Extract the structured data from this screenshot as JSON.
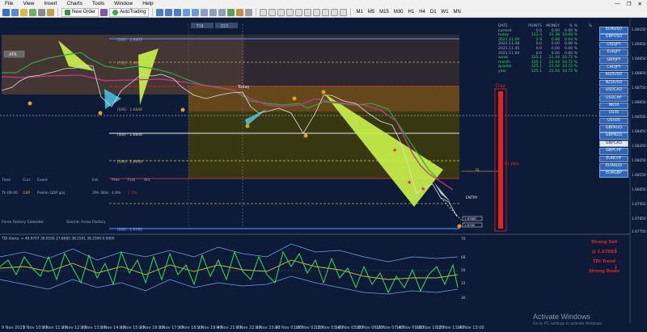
{
  "menu": [
    "File",
    "View",
    "Insert",
    "Charts",
    "Tools",
    "Window",
    "Help"
  ],
  "window_controls": [
    "—",
    "❐",
    "✕"
  ],
  "toolbar": {
    "new_order": "New Order",
    "auto_trading": "AutoTrading",
    "timeframes": [
      "M1",
      "M5",
      "M15",
      "M30",
      "H1",
      "H4",
      "D1",
      "W1",
      "MN"
    ]
  },
  "chart_labels": {
    "top_tags": [
      "T18",
      "Z23"
    ],
    "atr": "ATR",
    "today": "Today",
    "day": "Day",
    "pips": "81 pips",
    "entry": "ENTRY",
    "stop": "SL",
    "levels": [
      "[5/8] - 1.6903",
      "[7/8] - 1.6880",
      "[6/8] - 1.6848",
      "[4/8] - 1.6846",
      "[3/8] - 1.6830",
      "[0/8] - 1.6785"
    ],
    "price_boxes": [
      "1.6903",
      "1.6848",
      "1.6846",
      "1.6830",
      "1.6785",
      "1.67887",
      "1.6780"
    ]
  },
  "price_axis": [
    "1.69150",
    "1.69050",
    "1.68950",
    "1.68850",
    "1.68750",
    "1.68650",
    "1.68550",
    "1.68450",
    "1.68350",
    "1.68250",
    "1.68150",
    "1.68050",
    "1.67950",
    "1.67850",
    "1.67750"
  ],
  "indicator": {
    "header": "TDI Alerts: + 49.9707 38.0195 27.8685 38.2591 38.2590 0.0000",
    "axis": [
      "70",
      "68",
      "50",
      "32",
      "30"
    ],
    "signals": [
      "Strong Sell",
      "@ 1.67887",
      "TDI Trend",
      "Strong Down"
    ]
  },
  "data_table": {
    "headers": [
      "DATE",
      "POINTS",
      "MONEY",
      "% %",
      "%"
    ],
    "rows": [
      [
        "current",
        "0.0",
        "0.00",
        "0.00 %"
      ],
      [
        "today",
        "122.3",
        "31.38",
        "10.68 %"
      ],
      [
        "2021.11.09",
        "2.9",
        "0.88",
        "0.04 %"
      ],
      [
        "2021.11.08",
        "0.0",
        "0.00",
        "0.00 %"
      ],
      [
        "2021.11.05",
        "0.0",
        "0.00",
        "0.00 %"
      ],
      [
        "2021.11.04",
        "0.0",
        "0.00",
        "0.00 %"
      ],
      [
        "week",
        "125.1",
        "21.44",
        "10.72 %"
      ],
      [
        "month",
        "125.1",
        "21.44",
        "10.72 %"
      ],
      [
        "quarter",
        "125.1",
        "21.44",
        "10.72 %"
      ],
      [
        "year",
        "125.1",
        "21.44",
        "10.72 %"
      ]
    ]
  },
  "symbols": [
    "EURUSD",
    "GBPUSD",
    "USDJPY",
    "EURJPY",
    "GBPJPY",
    "CADJPY",
    "AUDUSD",
    "NZDUSD",
    "USDCAD",
    "USDCHF",
    "NK50",
    "US30",
    "US500",
    "GBPAUD",
    "GBPNZD",
    "GBPCAD",
    "GBPCHF",
    "EURCHF",
    "EURAUD",
    "EURGBP"
  ],
  "active_symbol": "GBPCAD",
  "news": {
    "headers": [
      "Time",
      "Curr.",
      "Event",
      "Est.",
      "Prev",
      "Fcst",
      "Act"
    ],
    "rows": [
      [
        "Th  09:00",
        "GBP",
        "Prelim GDP q/q",
        "29h 36m",
        "4.8%",
        "1.5%",
        ""
      ]
    ],
    "footer": [
      "Forex Factory Calendar",
      "Source: Forex Factory"
    ]
  },
  "time_axis": [
    "9 Nov 2021",
    "9 Nov 10:20",
    "9 Nov 11:20",
    "9 Nov 12:20",
    "9 Nov 13:20",
    "9 Nov 14:20",
    "9 Nov 15:20",
    "9 Nov 16:20",
    "9 Nov 17:20",
    "9 Nov 18:20",
    "9 Nov 19:40",
    "9 Nov 21:00",
    "9 Nov 22:20",
    "9 Nov 23:40",
    "10 Nov 01:00",
    "10 Nov 02:20",
    "10 Nov 03:40",
    "10 Nov 05:00",
    "10 Nov 06:20",
    "10 Nov 07:40",
    "10 Nov 09:00",
    "10 Nov 10:20",
    "10 Nov 11:40",
    "10 Nov 13:00"
  ],
  "watermark": {
    "title": "Activate Windows",
    "sub": "Go to PC settings to activate Windows."
  },
  "colors": {
    "background": "#0d1b38",
    "bull": "#c8f04a",
    "bear_line": "#c21d5b",
    "zone_high": "#4a3a33",
    "zone_mid": "#6b4a1a",
    "zone_low": "#3a3a0f",
    "tdi_green": "#3ddb57",
    "tdi_yellow": "#d6c233",
    "tdi_blue": "#6fa2e8",
    "signal_red": "#e02525"
  }
}
